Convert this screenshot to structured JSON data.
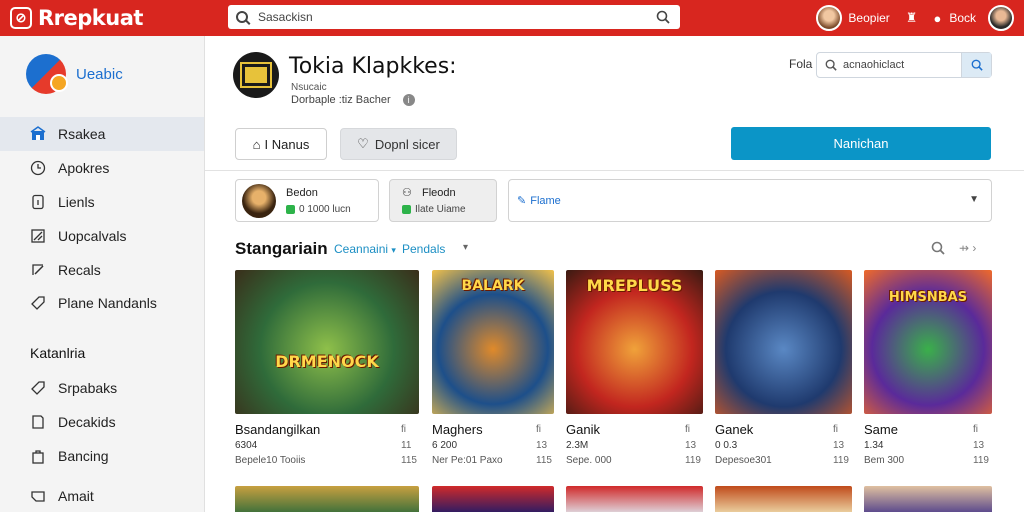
{
  "header": {
    "app_name": "Rrepkuat",
    "search_placeholder": "Sasackisn",
    "profile_label": "Beopier",
    "notifications_label": "Bock"
  },
  "sidebar": {
    "brand": "Ueabic",
    "items": [
      {
        "label": "Rsakea",
        "icon": "store-icon",
        "active": true
      },
      {
        "label": "Apokres",
        "icon": "clock-icon",
        "active": false
      },
      {
        "label": "Lienls",
        "icon": "info-icon",
        "active": false
      },
      {
        "label": "Uopcalvals",
        "icon": "update-icon",
        "active": false
      },
      {
        "label": "Recals",
        "icon": "edit-icon",
        "active": false
      },
      {
        "label": "Plane Nandanls",
        "icon": "tag-icon",
        "active": false
      }
    ],
    "section_title": "Katanlria",
    "section_items": [
      {
        "label": "Srpabaks",
        "icon": "tag-icon"
      },
      {
        "label": "Decakids",
        "icon": "box-icon"
      },
      {
        "label": "Bancing",
        "icon": "bag-icon"
      },
      {
        "label": "Amait",
        "icon": "mail-icon"
      }
    ]
  },
  "main": {
    "title": "Tokia Klapkkes:",
    "subtitle_small": "Nsucaic",
    "subtitle": "Dorbaple :tiz Bacher",
    "search_label": "Fola",
    "search_placeholder": "acnaohiclact",
    "button_outline": "I Nanus",
    "button_grey": "Dopnl sicer",
    "button_primary": "Nanichan"
  },
  "cards": [
    {
      "title": "Bedon",
      "sub": "0 1000 lucn"
    },
    {
      "title": "Fleodn",
      "sub": "Ilate Uiame"
    }
  ],
  "select": {
    "value": "Flame"
  },
  "section": {
    "title": "Stangariain",
    "filter1": "Ceannaini",
    "filter2": "Pendals"
  },
  "games": [
    {
      "art_title": "DRMENOCK",
      "name": "Bsandangilkan",
      "meta1": "6304",
      "meta2": "Bepele10 Tooiis",
      "side1": "fi",
      "side2": "11",
      "side3": "115",
      "colors": [
        "#2f6b3a",
        "#8fc04a",
        "#3a2e1a"
      ]
    },
    {
      "art_title": "BALARK",
      "name": "Maghers",
      "meta1": "6 200",
      "meta2": "Ner Pe:01 Paxo",
      "side1": "fi",
      "side2": "13",
      "side3": "115",
      "colors": [
        "#1d4f8a",
        "#e08a2a",
        "#f2c14a"
      ]
    },
    {
      "art_title": "MREPLUSS",
      "name": "Ganik",
      "meta1": "2.3M",
      "meta2": "Sepe. 000",
      "side1": "fi",
      "side2": "13",
      "side3": "119",
      "colors": [
        "#c2261f",
        "#f0a23a",
        "#3a1a12"
      ]
    },
    {
      "art_title": "",
      "name": "Ganek",
      "meta1": "0 0.3",
      "meta2": "Depesoe301",
      "side1": "fi",
      "side2": "13",
      "side3": "119",
      "colors": [
        "#1f3a6e",
        "#5a88c4",
        "#d85a22"
      ]
    },
    {
      "art_title": "HIMSNBAS",
      "name": "Same",
      "meta1": "1.34",
      "meta2": "Bem 300",
      "side1": "fi",
      "side2": "13",
      "side3": "119",
      "colors": [
        "#5a2a9a",
        "#3ab04a",
        "#f06a2a"
      ]
    }
  ],
  "row2_colors": [
    [
      "#2f6b3a",
      "#c8a040"
    ],
    [
      "#1a1a6a",
      "#d02a2a"
    ],
    [
      "#e0e8f0",
      "#d02a2a"
    ],
    [
      "#f0e0b0",
      "#c04a1a"
    ],
    [
      "#4a3a8a",
      "#e0c0a0"
    ]
  ],
  "colors": {
    "header_red": "#d8261f",
    "primary_blue": "#0b95c7",
    "link_blue": "#1c8fc4"
  }
}
